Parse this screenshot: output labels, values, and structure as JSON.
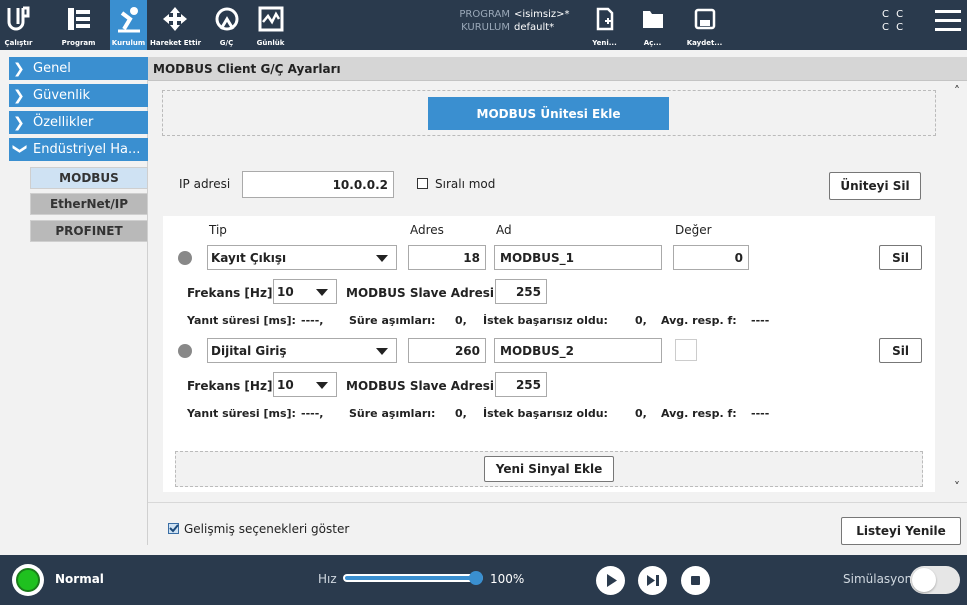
{
  "topbar": {
    "buttons": [
      {
        "label": "Çalıştır",
        "icon": "run-icon"
      },
      {
        "label": "Program",
        "icon": "program-icon"
      },
      {
        "label": "Kurulum",
        "icon": "installation-icon"
      },
      {
        "label": "Hareket Ettir",
        "icon": "move-icon"
      },
      {
        "label": "G/Ç",
        "icon": "io-icon"
      },
      {
        "label": "Günlük",
        "icon": "log-icon"
      }
    ],
    "program_label": "PROGRAM",
    "program_value": "<isimsiz>*",
    "installation_label": "KURULUM",
    "installation_value": "default*",
    "file_buttons": [
      {
        "label": "Yeni...",
        "icon": "new-file-icon"
      },
      {
        "label": "Aç...",
        "icon": "folder-icon"
      },
      {
        "label": "Kaydet...",
        "icon": "save-icon"
      }
    ],
    "cc_line1": "C C",
    "cc_line2": "C C"
  },
  "sidebar": {
    "items": [
      {
        "label": "Genel"
      },
      {
        "label": "Güvenlik"
      },
      {
        "label": "Özellikler"
      },
      {
        "label": "Endüstriyel Ha..."
      }
    ],
    "subitems": [
      {
        "label": "MODBUS"
      },
      {
        "label": "EtherNet/IP"
      },
      {
        "label": "PROFINET"
      }
    ]
  },
  "main": {
    "title": "MODBUS Client G/Ç Ayarları",
    "add_unit_label": "MODBUS Ünitesi Ekle",
    "ip_label": "IP adresi",
    "ip_value": "10.0.0.2",
    "sequential_label": "Sıralı mod",
    "delete_unit_label": "Üniteyi Sil",
    "headers": {
      "type": "Tip",
      "address": "Adres",
      "name": "Ad",
      "value": "Değer"
    },
    "signals": [
      {
        "type": "Kayıt Çıkışı",
        "address": "18",
        "name": "MODBUS_1",
        "value": "0",
        "delete_label": "Sil",
        "freq_label": "Frekans [Hz]",
        "freq_value": "10",
        "slave_label": "MODBUS Slave Adresi",
        "slave_value": "255",
        "stats": {
          "resp_label": "Yanıt süresi [ms]:",
          "resp_value": "----,",
          "timeout_label": "Süre aşımları:",
          "timeout_value": "0,",
          "fail_label": "İstek başarısız oldu:",
          "fail_value": "0,",
          "avg_label": "Avg. resp. f:",
          "avg_value": "----"
        }
      },
      {
        "type": "Dijital Giriş",
        "address": "260",
        "name": "MODBUS_2",
        "value": "",
        "delete_label": "Sil",
        "freq_label": "Frekans [Hz]",
        "freq_value": "10",
        "slave_label": "MODBUS Slave Adresi",
        "slave_value": "255",
        "stats": {
          "resp_label": "Yanıt süresi [ms]:",
          "resp_value": "----,",
          "timeout_label": "Süre aşımları:",
          "timeout_value": "0,",
          "fail_label": "İstek başarısız oldu:",
          "fail_value": "0,",
          "avg_label": "Avg. resp. f:",
          "avg_value": "----"
        }
      }
    ],
    "add_signal_label": "Yeni Sinyal Ekle",
    "advanced_label": "Gelişmiş seçenekleri göster",
    "refresh_label": "Listeyi Yenile"
  },
  "footer": {
    "status": "Normal",
    "speed_label": "Hız",
    "speed_value": "100%",
    "speed_fraction": 1.0,
    "simulation_label": "Simülasyon",
    "colors": {
      "status_green": "#1fc11f",
      "accent_blue": "#3a8fd0",
      "bar_bg": "#2a3a4d"
    }
  }
}
